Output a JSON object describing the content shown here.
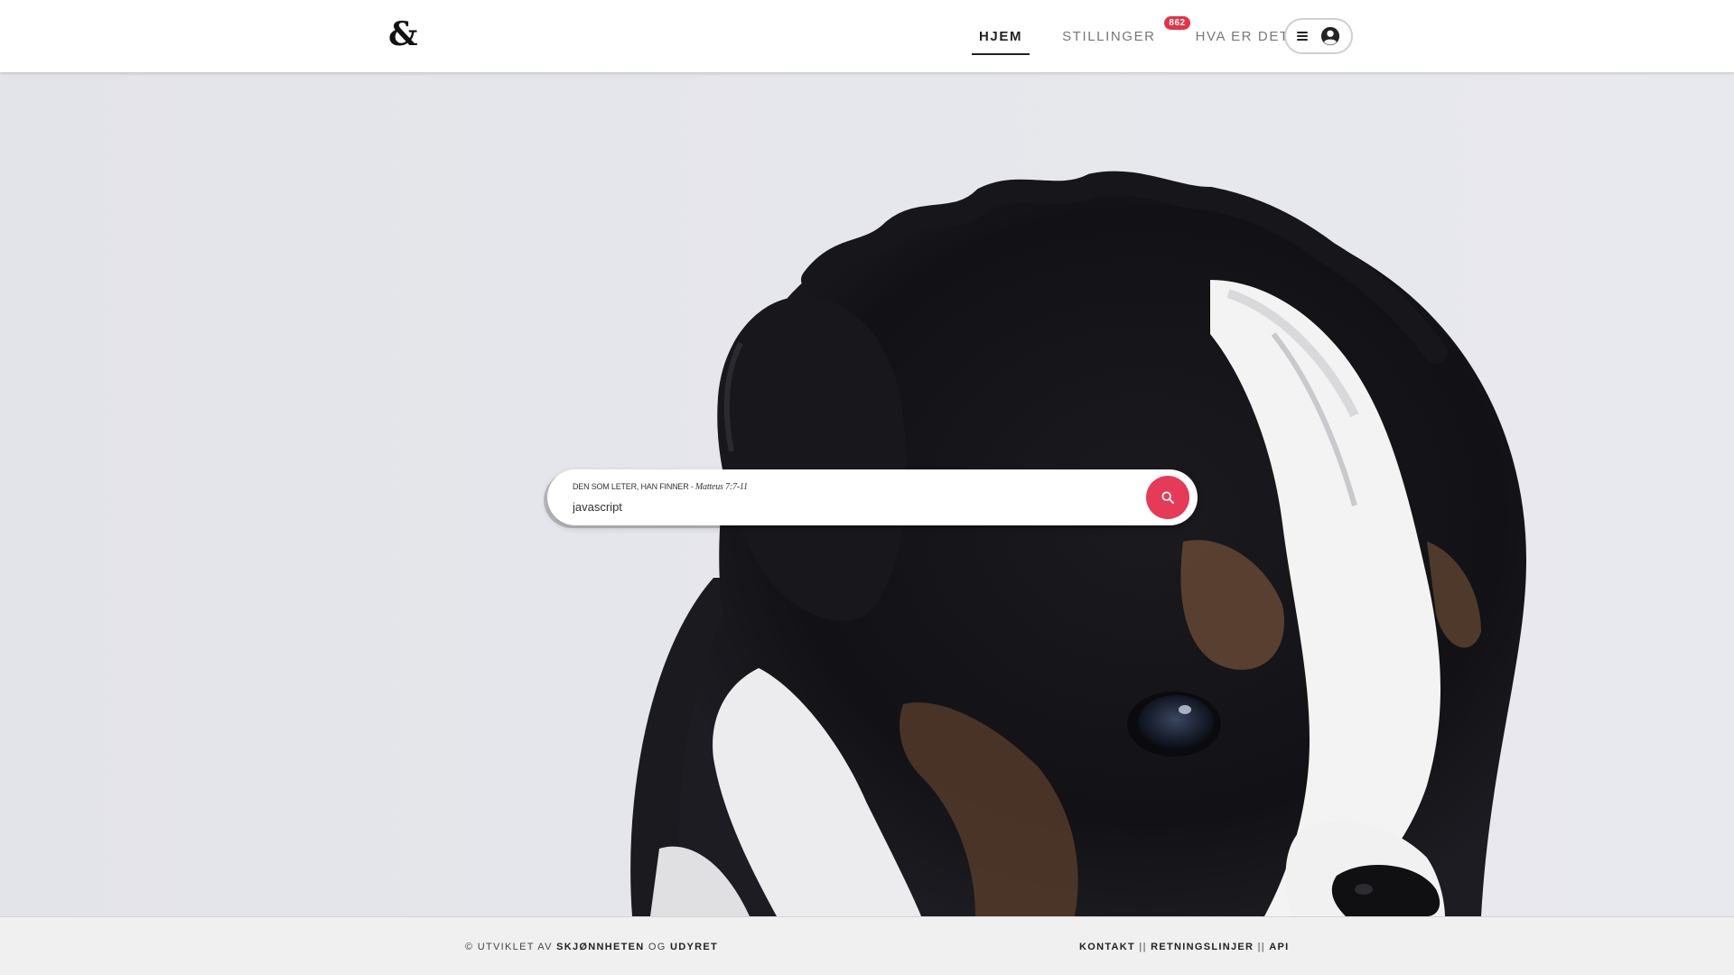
{
  "header": {
    "logo": "&",
    "nav": [
      {
        "label": "HJEM",
        "active": true
      },
      {
        "label": "STILLINGER",
        "badge": "862"
      },
      {
        "label": "HVA ER DETTE?"
      }
    ],
    "menu_icon": "hamburger-icon",
    "user_icon": "account-circle-icon"
  },
  "search": {
    "label_prefix": "DEN SOM LETER, HAN FINNER - ",
    "label_ref": "Matteus 7:7-11",
    "value": "javascript",
    "button_icon": "search-icon",
    "button_color": "#e53a58"
  },
  "footer": {
    "copyright": "© UTVIKLET AV ",
    "author_1": "SKJØNNHETEN",
    "conjunction": " OG ",
    "author_2": "UDYRET",
    "links": [
      "KONTAKT",
      "RETNINGSLINJER",
      "API"
    ],
    "separator": " || "
  },
  "colors": {
    "accent": "#e53a58",
    "badge": "#e0354b"
  }
}
